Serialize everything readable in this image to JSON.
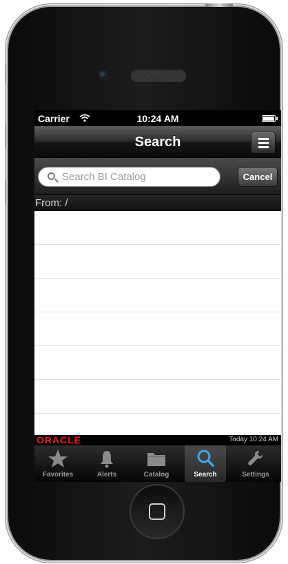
{
  "status_bar": {
    "carrier": "Carrier",
    "time": "10:24 AM"
  },
  "nav": {
    "title": "Search"
  },
  "search": {
    "placeholder": "Search BI Catalog",
    "cancel_label": "Cancel"
  },
  "from_label": "From: /",
  "footer": {
    "brand": "ORACLE",
    "timestamp": "Today 10:24 AM"
  },
  "tabs": [
    {
      "label": "Favorites",
      "icon": "star-icon"
    },
    {
      "label": "Alerts",
      "icon": "bell-icon"
    },
    {
      "label": "Catalog",
      "icon": "folder-icon"
    },
    {
      "label": "Search",
      "icon": "search-icon",
      "active": true
    },
    {
      "label": "Settings",
      "icon": "wrench-icon"
    }
  ],
  "colors": {
    "brand": "#e8231f",
    "tab_active": "#ffffff",
    "tab_inactive": "#9a9a9a"
  }
}
